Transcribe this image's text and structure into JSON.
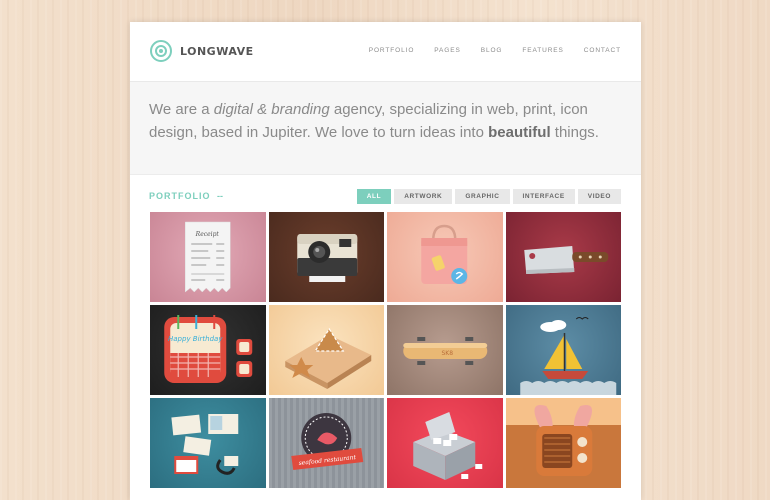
{
  "brand": {
    "name": "LONGWAVE",
    "color": "#7dcfbd"
  },
  "nav": {
    "items": [
      {
        "label": "PORTFOLIO"
      },
      {
        "label": "PAGES"
      },
      {
        "label": "BLOG"
      },
      {
        "label": "FEATURES"
      },
      {
        "label": "CONTACT"
      }
    ]
  },
  "intro": {
    "part1": "We are a ",
    "em": "digital & branding",
    "part2": " agency, specializing in web, print, icon design, based in Jupiter. We love to turn ideas into ",
    "strong": "beautiful",
    "part3": " things."
  },
  "portfolio": {
    "title": "PORTFOLIO",
    "dash": "--",
    "filters": [
      {
        "label": "ALL",
        "active": true
      },
      {
        "label": "ARTWORK",
        "active": false
      },
      {
        "label": "GRAPHIC",
        "active": false
      },
      {
        "label": "INTERFACE",
        "active": false
      },
      {
        "label": "VIDEO",
        "active": false
      }
    ],
    "tiles": [
      {
        "icon": "receipt-icon",
        "caption": "Receipt"
      },
      {
        "icon": "camera-icon"
      },
      {
        "icon": "shopping-bag-icon"
      },
      {
        "icon": "cleaver-knife-icon"
      },
      {
        "icon": "birthday-cake-icon",
        "caption": "Happy Birthday"
      },
      {
        "icon": "cookie-icon"
      },
      {
        "icon": "skateboard-icon",
        "caption": "SK8"
      },
      {
        "icon": "sailboat-icon"
      },
      {
        "icon": "stamps-icon"
      },
      {
        "icon": "badge-icon",
        "caption": "seafood restaurant"
      },
      {
        "icon": "box-icon"
      },
      {
        "icon": "radio-icon"
      }
    ]
  }
}
